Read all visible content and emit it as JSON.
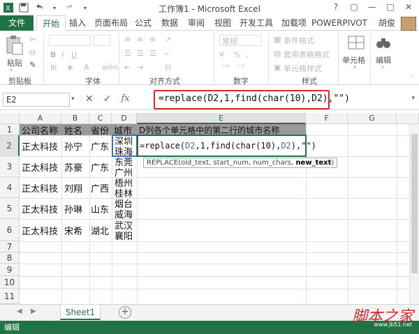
{
  "window": {
    "title": "工作簿1 - Microsoft Excel",
    "controls": [
      "?",
      "▢",
      "—",
      "□",
      "✕"
    ]
  },
  "tabs": [
    "文件",
    "开始",
    "插入",
    "页面布局",
    "公式",
    "数据",
    "审阅",
    "视图",
    "开发工具",
    "加载项",
    "POWERPIVOT"
  ],
  "active_tab": "开始",
  "user": "胡俊",
  "ribbon": {
    "clipboard": {
      "paste": "粘贴",
      "label": "剪贴板"
    },
    "font": {
      "label": "字体"
    },
    "alignment": {
      "label": "对齐方式"
    },
    "number": {
      "label": "数字",
      "format": "常规",
      "percent": "%"
    },
    "styles": {
      "conditional": "条件格式",
      "table": "套用表格格式",
      "cell_styles": "单元格样式",
      "label": "样式"
    },
    "cells": {
      "label": "单元格"
    },
    "editing": {
      "label": "编辑"
    }
  },
  "formula_bar": {
    "name_box": "E2",
    "cancel": "✕",
    "enter": "✓",
    "fx": "fx",
    "formula": "=replace(D2,1,find(char(10),D2),\"\")"
  },
  "columns": [
    "A",
    "B",
    "C",
    "D",
    "E",
    "F",
    "G"
  ],
  "rows": [
    "1",
    "2",
    "3",
    "4",
    "5",
    "6",
    "7",
    "8",
    "9",
    "10",
    "11"
  ],
  "cells": {
    "A1": "公司名称",
    "B1": "姓名",
    "C1": "省份",
    "D1": "城市",
    "E1": "D列各个单元格中的第二行的城市名称",
    "A2": "正太科技",
    "B2": "孙宁",
    "C2": "广东",
    "D2_line1": "深圳",
    "D2_line2": "珠海",
    "A3": "正太科技",
    "B3": "苏豪",
    "C3": "广东",
    "D3_line1": "东莞",
    "D3_line2": "广州",
    "A4": "正太科技",
    "B4": "刘翔",
    "C4": "广西",
    "D4_line1": "梧州",
    "D4_line2": "桂林",
    "A5": "正太科技",
    "B5": "孙琳",
    "C5": "山东",
    "D5_line1": "烟台",
    "D5_line2": "威海",
    "A6": "正太科技",
    "B6": "宋希",
    "C6": "湖北",
    "D6_line1": "武汉",
    "D6_line2": "襄阳"
  },
  "editing_cell": {
    "prefix": "=replace(",
    "ref1": "D2",
    "mid": ",1,find(char(10),",
    "ref2": "D2",
    "suffix": "),\"\")"
  },
  "tooltip": {
    "fn": "REPLACE(old_text, start_num, num_chars, ",
    "current_arg": "new_text",
    "close": ")"
  },
  "sheet": {
    "name": "Sheet1",
    "add": "+"
  },
  "status": "编辑",
  "watermark": {
    "text": "脚本之家",
    "sub": "www.jb51.net"
  }
}
